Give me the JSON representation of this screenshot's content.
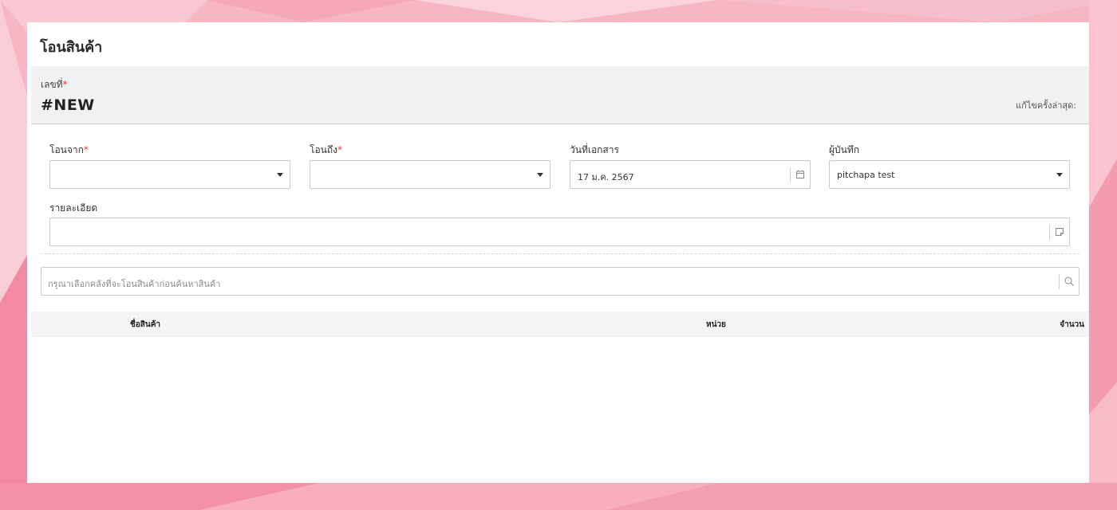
{
  "page": {
    "title": "โอนสินค้า"
  },
  "document": {
    "number_label": "เลขที่",
    "required_mark": "*",
    "number_value": "#NEW",
    "last_edit_label": "แก้ไขครั้งล่าสุด:"
  },
  "form": {
    "from": {
      "label": "โอนจาก",
      "value": ""
    },
    "to": {
      "label": "โอนถึง",
      "value": ""
    },
    "doc_date": {
      "label": "วันที่เอกสาร",
      "value": "17 ม.ค. 2567"
    },
    "recorder": {
      "label": "ผู้บันทึก",
      "value": "pitchapa test"
    },
    "detail": {
      "label": "รายละเอียด",
      "value": ""
    }
  },
  "search": {
    "placeholder": "กรุณาเลือกคลังที่จะโอนสินค้าก่อนค้นหาสินค้า"
  },
  "table": {
    "columns": [
      "ชื่อสินค้า",
      "หน่วย",
      "จำนวน"
    ]
  },
  "colors": {
    "required": "#e03a3a",
    "background_pink": "#f7b3c2"
  },
  "icons": {
    "dropdown": "caret-down-icon",
    "date": "calendar-icon",
    "detail": "note-icon",
    "search": "search-icon"
  }
}
